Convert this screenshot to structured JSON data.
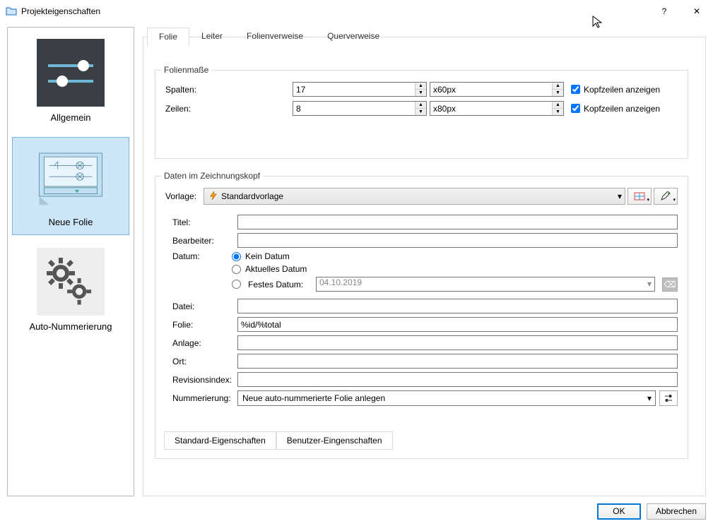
{
  "window": {
    "title": "Projekteigenschaften",
    "help": "?",
    "close": "✕"
  },
  "sidebar": {
    "items": [
      {
        "label": "Allgemein"
      },
      {
        "label": "Neue Folie"
      },
      {
        "label": "Auto-Nummerierung"
      }
    ]
  },
  "tabs": [
    "Folie",
    "Leiter",
    "Folienverweise",
    "Querverweise"
  ],
  "folienmasse": {
    "title": "Folienmaße",
    "spalten_label": "Spalten:",
    "spalten_value": "17",
    "spalten_px": "x60px",
    "zeilen_label": "Zeilen:",
    "zeilen_value": "8",
    "zeilen_px": "x80px",
    "kopfzeilen_label": "Kopfzeilen anzeigen"
  },
  "daten": {
    "title": "Daten im Zeichnungskopf",
    "vorlage_label": "Vorlage:",
    "vorlage_value": "Standardvorlage",
    "fields": {
      "titel": {
        "label": "Titel:",
        "value": ""
      },
      "bearbeiter": {
        "label": "Bearbeiter:",
        "value": ""
      },
      "datum": {
        "label": "Datum:"
      },
      "datum_options": {
        "kein": "Kein Datum",
        "aktuell": "Aktuelles Datum",
        "fest": "Festes Datum:"
      },
      "festes_datum_value": "04.10.2019",
      "datei": {
        "label": "Datei:",
        "value": ""
      },
      "folie": {
        "label": "Folie:",
        "value": "%id/%total"
      },
      "anlage": {
        "label": "Anlage:",
        "value": ""
      },
      "ort": {
        "label": "Ort:",
        "value": ""
      },
      "revision": {
        "label": "Revisionsindex:",
        "value": ""
      },
      "nummerierung": {
        "label": "Nummerierung:",
        "value": "Neue auto-nummerierte Folie anlegen"
      }
    }
  },
  "subtabs": [
    "Standard-Eigenschaften",
    "Benutzer-Eingenschaften"
  ],
  "footer": {
    "ok": "OK",
    "cancel": "Abbrechen"
  }
}
